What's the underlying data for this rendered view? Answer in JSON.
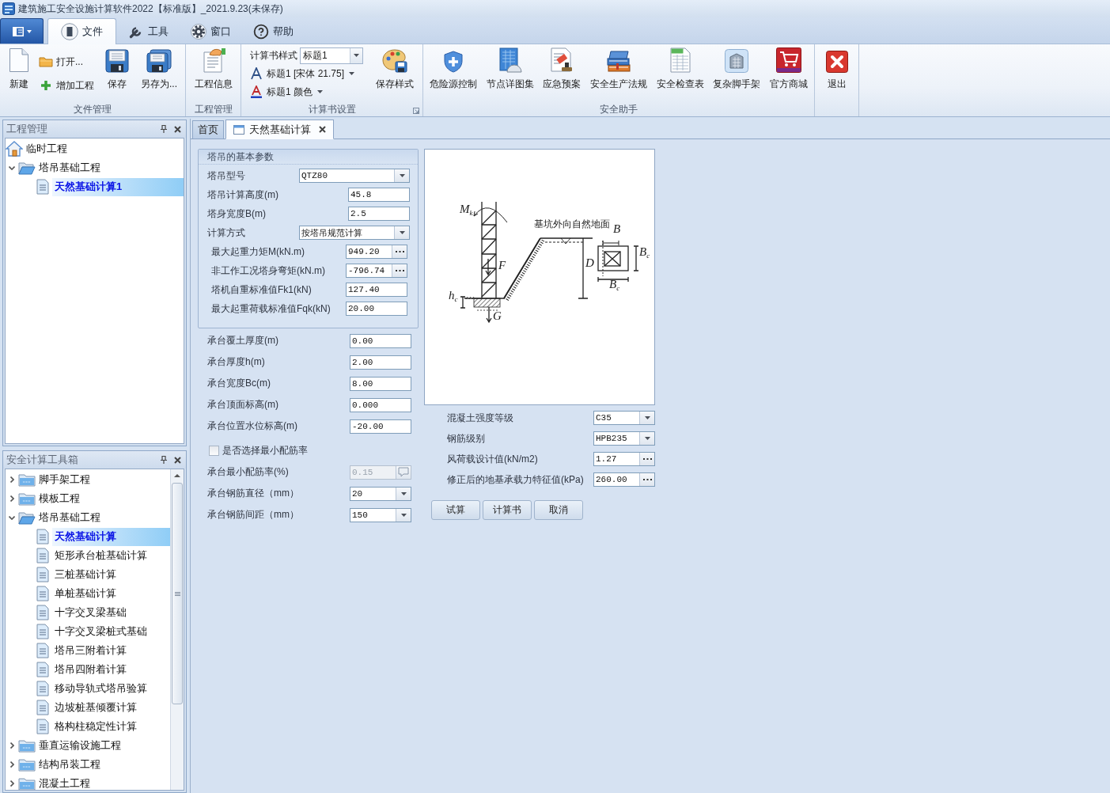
{
  "window": {
    "title": "建筑施工安全设施计算软件2022【标准版】_2021.9.23(未保存)"
  },
  "ribbon": {
    "tabs": [
      {
        "label": "文件",
        "selected": true
      },
      {
        "label": "工具",
        "selected": false
      },
      {
        "label": "窗口",
        "selected": false
      },
      {
        "label": "帮助",
        "selected": false
      }
    ],
    "groups": [
      {
        "label": "文件管理",
        "items": [
          {
            "kind": "large",
            "label": "新建"
          },
          {
            "kind": "stack",
            "items": [
              {
                "kind": "small",
                "label": "打开..."
              },
              {
                "kind": "small",
                "label": "增加工程"
              }
            ]
          },
          {
            "kind": "large",
            "label": "保存"
          },
          {
            "kind": "large",
            "label": "另存为..."
          }
        ]
      },
      {
        "label": "工程管理",
        "items": [
          {
            "kind": "large",
            "label": "工程信息"
          }
        ]
      },
      {
        "label": "计算书设置",
        "launcher": true,
        "items": [
          {
            "kind": "stack",
            "items": [
              {
                "kind": "combo",
                "label": "计算书样式",
                "value": "标题1"
              },
              {
                "kind": "dropdown",
                "label": "标题1 [宋体 21.75]"
              },
              {
                "kind": "dropdown",
                "label": "标题1 颜色"
              }
            ]
          },
          {
            "kind": "large",
            "label": "保存样式"
          }
        ]
      },
      {
        "label": "安全助手",
        "items": [
          {
            "kind": "large",
            "label": "危险源控制"
          },
          {
            "kind": "large",
            "label": "节点详图集"
          },
          {
            "kind": "large",
            "label": "应急预案"
          },
          {
            "kind": "large",
            "label": "安全生产法规"
          },
          {
            "kind": "large",
            "label": "安全检查表"
          },
          {
            "kind": "large",
            "label": "复杂脚手架"
          },
          {
            "kind": "large",
            "label": "官方商城"
          }
        ]
      },
      {
        "items": [
          {
            "kind": "large",
            "label": "退出"
          }
        ]
      }
    ]
  },
  "panels": [
    {
      "title": "工程管理",
      "tree": {
        "label": "临时工程",
        "selected": false,
        "children": [
          {
            "label": "塔吊基础工程",
            "expanded": true,
            "selected": false,
            "children": [
              {
                "label": "天然基础计算1",
                "selected": true
              }
            ]
          }
        ]
      }
    },
    {
      "title": "安全计算工具箱",
      "tree": {
        "children": [
          {
            "label": "脚手架工程",
            "expanded": false,
            "selected": false
          },
          {
            "label": "模板工程",
            "expanded": false,
            "selected": false
          },
          {
            "label": "塔吊基础工程",
            "expanded": true,
            "selected": false,
            "children": [
              {
                "label": "天然基础计算",
                "selected": true
              },
              {
                "label": "矩形承台桩基础计算",
                "selected": false
              },
              {
                "label": "三桩基础计算",
                "selected": false
              },
              {
                "label": "单桩基础计算",
                "selected": false
              },
              {
                "label": "十字交叉梁基础",
                "selected": false
              },
              {
                "label": "十字交叉梁桩式基础",
                "selected": false
              },
              {
                "label": "塔吊三附着计算",
                "selected": false
              },
              {
                "label": "塔吊四附着计算",
                "selected": false
              },
              {
                "label": "移动导轨式塔吊验算",
                "selected": false
              },
              {
                "label": "边坡桩基倾覆计算",
                "selected": false
              },
              {
                "label": "格构柱稳定性计算",
                "selected": false
              }
            ]
          },
          {
            "label": "垂直运输设施工程",
            "expanded": false,
            "selected": false
          },
          {
            "label": "结构吊装工程",
            "expanded": false,
            "selected": false
          },
          {
            "label": "混凝土工程",
            "expanded": false,
            "selected": false
          }
        ]
      }
    }
  ],
  "document_tabs": [
    {
      "label": "首页",
      "selected": false
    },
    {
      "label": "天然基础计算",
      "selected": true
    }
  ],
  "form": {
    "basic_group": {
      "title": "塔吊的基本参数",
      "fields": [
        {
          "label": "塔吊型号",
          "kind": "select",
          "value": "QTZ80"
        },
        {
          "label": "塔吊计算高度(m)",
          "kind": "input",
          "value": "45.8"
        },
        {
          "label": "塔身宽度B(m)",
          "kind": "input",
          "value": "2.5"
        },
        {
          "label": "计算方式",
          "kind": "select",
          "value": "按塔吊规范计算"
        },
        {
          "label": "最大起重力矩M(kN.m)",
          "kind": "picker",
          "value": "949.20"
        },
        {
          "label": "非工作工况塔身弯矩(kN.m)",
          "kind": "picker",
          "value": "-796.74"
        },
        {
          "label": "塔机自重标准值Fk1(kN)",
          "kind": "input",
          "value": "127.40"
        },
        {
          "label": "最大起重荷载标准值Fqk(kN)",
          "kind": "input",
          "value": "20.00"
        }
      ]
    },
    "cap_fields": [
      {
        "label": "承台覆土厚度(m)",
        "kind": "input",
        "value": "0.00"
      },
      {
        "label": "承台厚度h(m)",
        "kind": "input",
        "value": "2.00"
      },
      {
        "label": "承台宽度Bc(m)",
        "kind": "input",
        "value": "8.00"
      },
      {
        "label": "承台顶面标高(m)",
        "kind": "input",
        "value": "0.000"
      },
      {
        "label": "承台位置水位标高(m)",
        "kind": "input",
        "value": "-20.00"
      }
    ],
    "min_ratio_checkbox": {
      "label": "是否选择最小配筋率",
      "checked": false
    },
    "rebar_fields": [
      {
        "label": "承台最小配筋率(%)",
        "kind": "note",
        "value": "0.15",
        "disabled": true
      },
      {
        "label": "承台钢筋直径（mm）",
        "kind": "select",
        "value": "20",
        "disabled": false
      },
      {
        "label": "承台钢筋间距（mm）",
        "kind": "select",
        "value": "150",
        "disabled": false
      }
    ],
    "diagram": {
      "labels": [
        "基坑外向自然地面",
        "M$_{k}$",
        "F",
        "D",
        "B",
        "B$_{c}$",
        "B$_{c}$",
        "h$_{c}$",
        "G"
      ]
    },
    "material_fields": [
      {
        "label": "混凝土强度等级",
        "kind": "select",
        "value": "C35"
      },
      {
        "label": "钢筋级别",
        "kind": "select",
        "value": "HPB235"
      },
      {
        "label": "风荷载设计值(kN/m2)",
        "kind": "picker",
        "value": "1.27"
      },
      {
        "label": "修正后的地基承载力特征值(kPa)",
        "kind": "picker",
        "value": "260.00"
      }
    ],
    "buttons": [
      "试算",
      "计算书",
      "取消"
    ]
  }
}
